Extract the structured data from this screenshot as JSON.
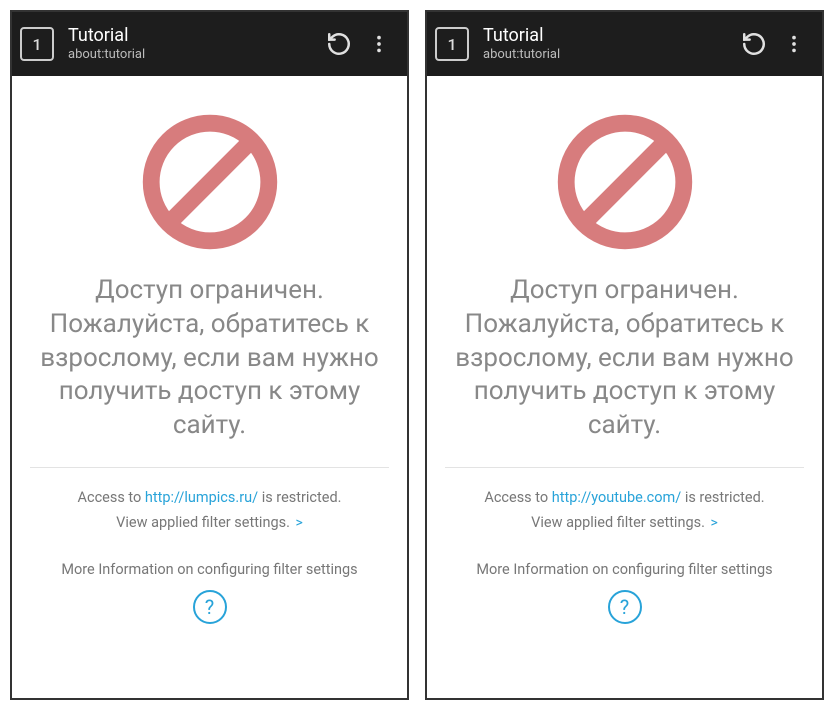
{
  "screens": [
    {
      "toolbar": {
        "tab_count": "1",
        "title": "Tutorial",
        "subtitle": "about:tutorial"
      },
      "headline": "Доступ ограничен. Пожалуйста, обратитесь к взрослому, если вам нужно получить доступ к этому сайту.",
      "access_prefix": "Access to ",
      "access_url": "http://lumpics.ru/",
      "access_suffix": " is restricted.",
      "filter_link": "View applied filter settings. ",
      "more_info": "More Information on configuring filter settings",
      "help_glyph": "?"
    },
    {
      "toolbar": {
        "tab_count": "1",
        "title": "Tutorial",
        "subtitle": "about:tutorial"
      },
      "headline": "Доступ ограничен. Пожалуйста, обратитесь к взрослому, если вам нужно получить доступ к этому сайту.",
      "access_prefix": "Access to ",
      "access_url": "http://youtube.com/",
      "access_suffix": " is restricted.",
      "filter_link": "View applied filter settings. ",
      "more_info": "More Information on configuring filter settings",
      "help_glyph": "?"
    }
  ]
}
